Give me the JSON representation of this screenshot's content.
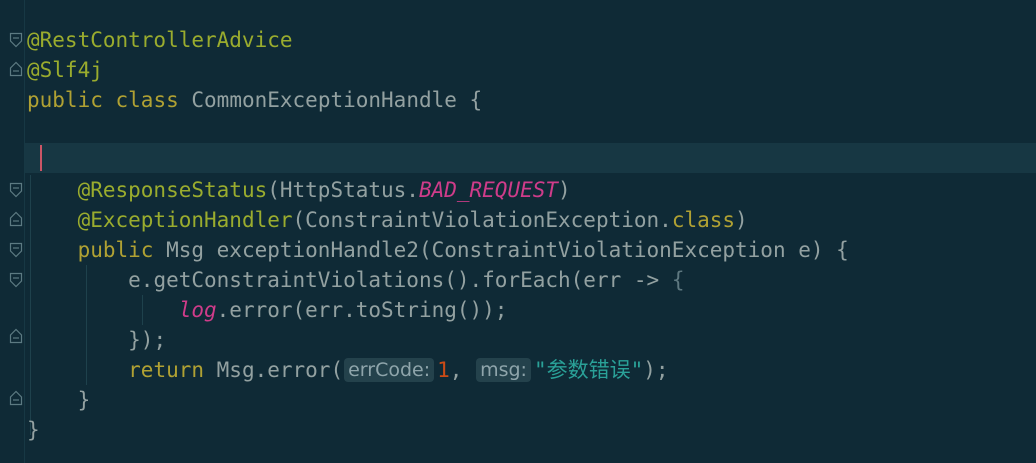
{
  "editor": {
    "lines": {
      "l1": {
        "annotation": "@RestControllerAdvice"
      },
      "l2": {
        "annotation": "@Slf4j"
      },
      "l3": {
        "kw_public": "public",
        "kw_class": "class",
        "class_name": "CommonExceptionHandle",
        "brace": " {"
      },
      "l6": {
        "annotation": "@ResponseStatus",
        "open": "(HttpStatus.",
        "constant": "BAD_REQUEST",
        "close": ")"
      },
      "l7": {
        "annotation": "@ExceptionHandler",
        "open": "(ConstraintViolationException.",
        "kw": "class",
        "close": ")"
      },
      "l8": {
        "kw_public": "public",
        "rest": " Msg exceptionHandle2(ConstraintViolationException e) {"
      },
      "l9": {
        "code": "e.getConstraintViolations().forEach(err -> ",
        "brace": "{"
      },
      "l10": {
        "field": "log",
        "rest": ".error(err.toString());"
      },
      "l11": {
        "code": "});"
      },
      "l12": {
        "kw_return": "return",
        "call": " Msg.error(",
        "hint1": "errCode:",
        "num": "1",
        "sep": ", ",
        "hint2": "msg:",
        "str": "\"参数错误\"",
        "end": ");"
      },
      "l13": {
        "code": "}"
      },
      "l14": {
        "code": "}"
      }
    },
    "colors": {
      "background": "#0f2a36",
      "current_line": "#173743",
      "annotation": "#9aac2e",
      "keyword": "#b0a133",
      "static_field": "#cf3c8a",
      "number": "#cb4b16",
      "string": "#2aa198",
      "caret": "#cc5566"
    },
    "icons": {
      "fold_open": "fold-open-icon",
      "fold_close": "fold-end-icon"
    }
  }
}
